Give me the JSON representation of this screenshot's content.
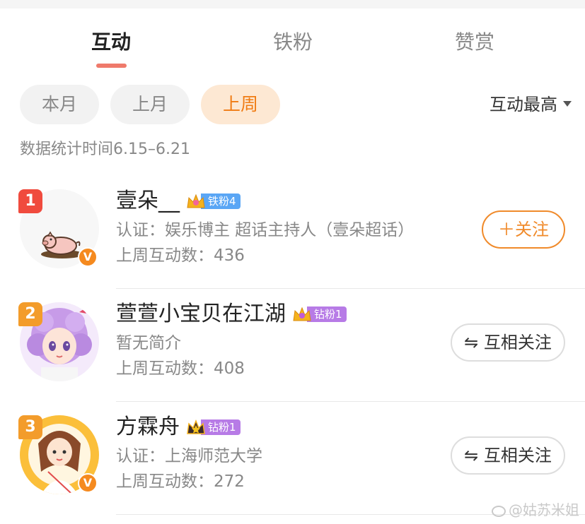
{
  "tabs": [
    {
      "label": "互动",
      "active": true
    },
    {
      "label": "铁粉",
      "active": false
    },
    {
      "label": "赞赏",
      "active": false
    }
  ],
  "filters": {
    "chips": [
      {
        "label": "本月",
        "active": false
      },
      {
        "label": "上月",
        "active": false
      },
      {
        "label": "上周",
        "active": true
      }
    ],
    "sort_label": "互动最高",
    "sort_icon": "caret-down-icon"
  },
  "stat_time": "数据统计时间6.15–6.21",
  "users": [
    {
      "rank": "1",
      "name": "壹朵__",
      "fan_badge": "铁粉4",
      "desc": "认证：娱乐博主 超话主持人（壹朵超话）",
      "count": "上周互动数：436",
      "verified": "V",
      "button": "＋关注",
      "button_type": "follow"
    },
    {
      "rank": "2",
      "name": "萱萱小宝贝在江湖",
      "fan_badge": "钻粉1",
      "desc": "暂无简介",
      "count": "上周互动数：408",
      "button": "⇋ 互相关注",
      "button_type": "mutual"
    },
    {
      "rank": "3",
      "name": "方霖舟",
      "fan_badge": "钻粉1",
      "desc": "认证：上海师范大学",
      "count": "上周互动数：272",
      "verified": "V",
      "button": "⇋ 互相关注",
      "button_type": "mutual"
    }
  ],
  "watermark": "@姑苏米姐",
  "colors": {
    "accent_orange": "#f07c14",
    "tab_indicator": "#ef7a6b",
    "iron_fan": "#5aa6f5",
    "diamond_fan": "#b77be6",
    "rank1": "#f04b3e",
    "rank_other": "#f39c2b"
  }
}
